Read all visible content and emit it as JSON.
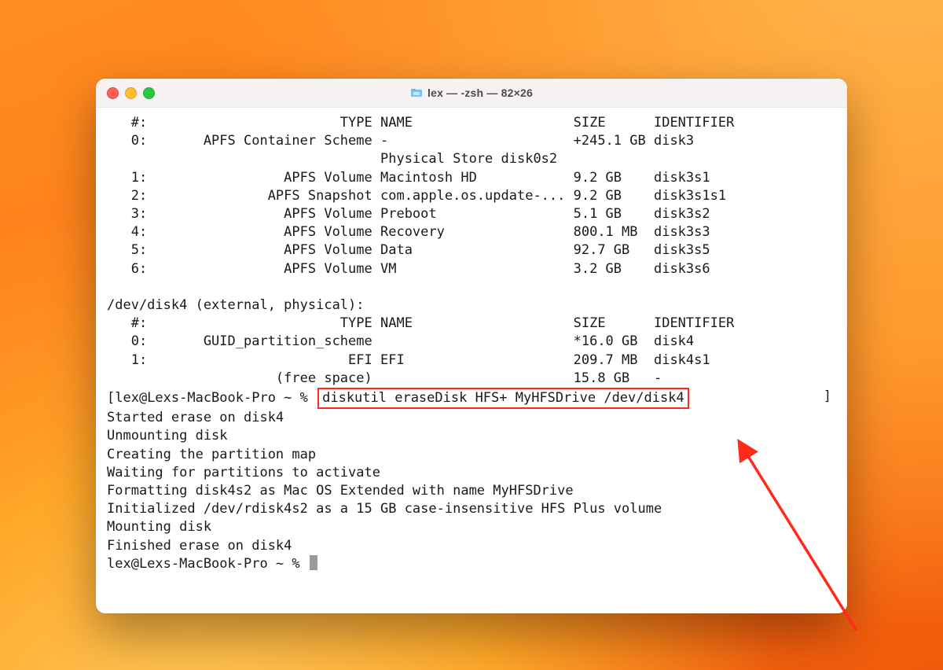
{
  "window": {
    "title": "lex — -zsh — 82×26"
  },
  "diskutil": {
    "headers": {
      "num": "#:",
      "type": "TYPE",
      "name": "NAME",
      "size": "SIZE",
      "id": "IDENTIFIER"
    },
    "disk3": [
      {
        "num": "0:",
        "type": "APFS Container Scheme",
        "name": "-",
        "size": "+245.1 GB",
        "id": "disk3"
      },
      {
        "num": "",
        "type": "",
        "name": "Physical Store disk0s2",
        "size": "",
        "id": ""
      },
      {
        "num": "1:",
        "type": "APFS Volume",
        "name": "Macintosh HD",
        "size": "9.2 GB",
        "id": "disk3s1"
      },
      {
        "num": "2:",
        "type": "APFS Snapshot",
        "name": "com.apple.os.update-...",
        "size": "9.2 GB",
        "id": "disk3s1s1"
      },
      {
        "num": "3:",
        "type": "APFS Volume",
        "name": "Preboot",
        "size": "5.1 GB",
        "id": "disk3s2"
      },
      {
        "num": "4:",
        "type": "APFS Volume",
        "name": "Recovery",
        "size": "800.1 MB",
        "id": "disk3s3"
      },
      {
        "num": "5:",
        "type": "APFS Volume",
        "name": "Data",
        "size": "92.7 GB",
        "id": "disk3s5"
      },
      {
        "num": "6:",
        "type": "APFS Volume",
        "name": "VM",
        "size": "3.2 GB",
        "id": "disk3s6"
      }
    ],
    "disk4_header": "/dev/disk4 (external, physical):",
    "disk4": [
      {
        "num": "0:",
        "type": "GUID_partition_scheme",
        "name": "",
        "size": "*16.0 GB",
        "id": "disk4"
      },
      {
        "num": "1:",
        "type": "EFI",
        "name": "EFI",
        "size": "209.7 MB",
        "id": "disk4s1"
      },
      {
        "num": "",
        "type": "(free space)",
        "name": "",
        "size": "15.8 GB",
        "id": "-"
      }
    ]
  },
  "command": {
    "prompt": "lex@Lexs-MacBook-Pro ~ %",
    "text": "diskutil eraseDisk HFS+ MyHFSDrive /dev/disk4"
  },
  "output": [
    "Started erase on disk4",
    "Unmounting disk",
    "Creating the partition map",
    "Waiting for partitions to activate",
    "Formatting disk4s2 as Mac OS Extended with name MyHFSDrive",
    "Initialized /dev/rdisk4s2 as a 15 GB case-insensitive HFS Plus volume",
    "Mounting disk",
    "Finished erase on disk4"
  ],
  "final_prompt": "lex@Lexs-MacBook-Pro ~ %"
}
